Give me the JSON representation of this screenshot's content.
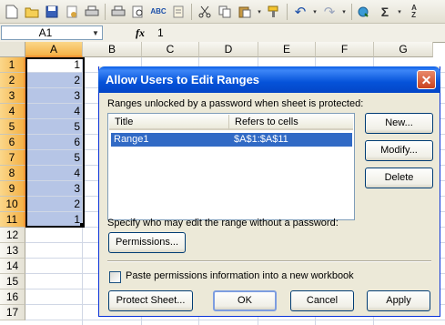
{
  "toolbar": {
    "icons": [
      "new-icon",
      "open-icon",
      "save-icon",
      "permission-icon",
      "print-icon",
      "print-preview-icon",
      "spelling-icon",
      "research-icon",
      "cut-icon",
      "copy-icon",
      "paste-icon",
      "format-painter-icon",
      "undo-icon",
      "redo-icon",
      "hyperlink-icon",
      "autosum-icon",
      "sort-icon"
    ],
    "spelling_text": "ABC"
  },
  "formula_bar": {
    "name_box": "A1",
    "fx_label": "fx",
    "value": "1"
  },
  "columns": [
    "A",
    "B",
    "C",
    "D",
    "E",
    "F",
    "G"
  ],
  "rows": [
    "1",
    "2",
    "3",
    "4",
    "5",
    "6",
    "7",
    "8",
    "9",
    "10",
    "11",
    "12",
    "13",
    "14",
    "15",
    "16",
    "17"
  ],
  "column_a_values": [
    "1",
    "2",
    "3",
    "4",
    "5",
    "6",
    "5",
    "4",
    "3",
    "2",
    "1"
  ],
  "dialog": {
    "title": "Allow Users to Edit Ranges",
    "close_glyph": "✕",
    "ranges_label": "Ranges unlocked by a password when sheet is protected:",
    "list_headers": {
      "title": "Title",
      "refers": "Refers to cells"
    },
    "list_rows": [
      {
        "title": "Range1",
        "refers": "$A$1:$A$11"
      }
    ],
    "buttons": {
      "new": "New...",
      "modify": "Modify...",
      "delete": "Delete",
      "permissions": "Permissions...",
      "protect_sheet": "Protect Sheet...",
      "ok": "OK",
      "cancel": "Cancel",
      "apply": "Apply"
    },
    "specify_label": "Specify who may edit the range without a password:",
    "paste_checkbox_label": "Paste permissions information into a new workbook",
    "paste_checked": false
  },
  "colors": {
    "selection_header": "#f4b146",
    "selection_fill": "#b6c5e6",
    "title_bar": "#0552d9",
    "list_selection": "#316ac5"
  }
}
